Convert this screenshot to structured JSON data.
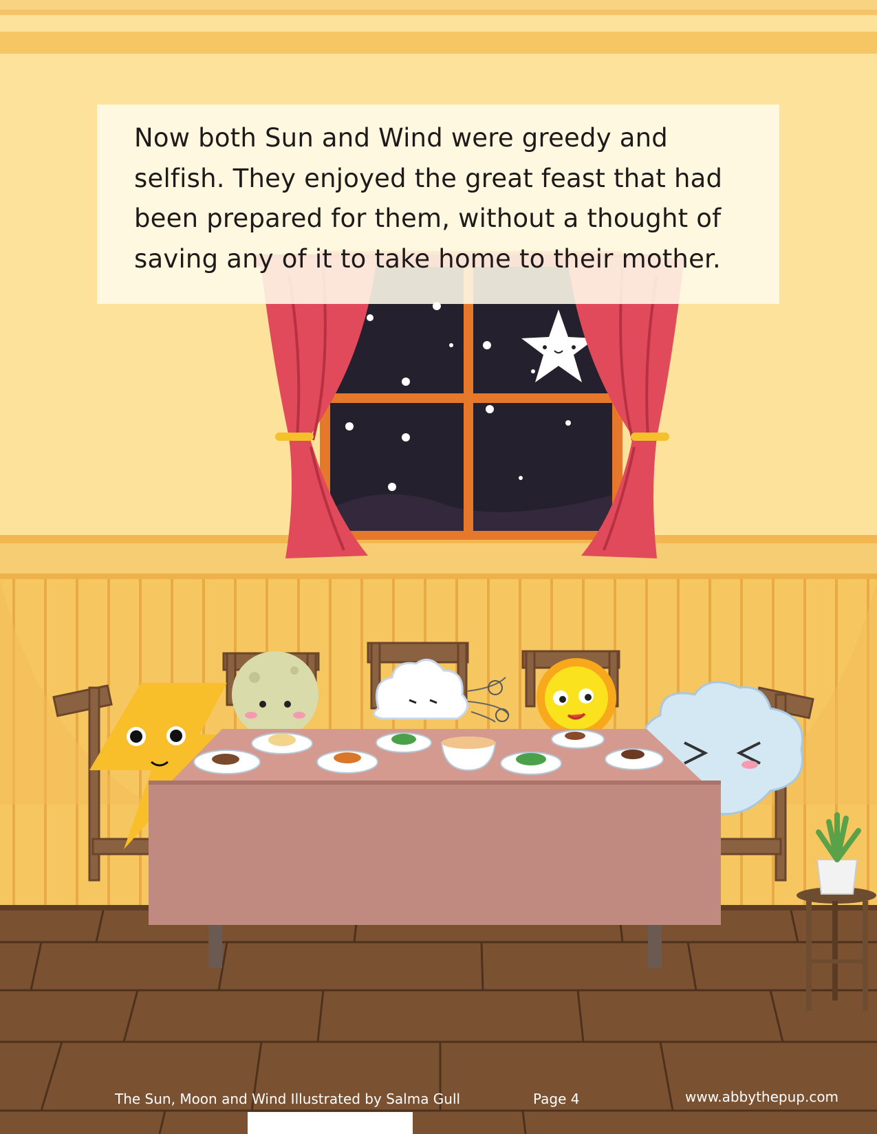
{
  "story": {
    "lines": [
      "Now both Sun and Wind were greedy and",
      "selfish. They enjoyed the great feast that had",
      "been prepared for them, without a thought of",
      "saving any of it to take home to their mother."
    ]
  },
  "footer": {
    "credit": "The Sun, Moon and Wind Illustrated by Salma Gull",
    "page": "Page 4",
    "url": "www.abbythepup.com"
  },
  "colors": {
    "wall": "#fce29a",
    "wainscot": "#f6c25a",
    "floor": "#7a5232",
    "curtain": "#e04a5a",
    "tablecloth": "#c08a80",
    "night_sky": "#25202e"
  },
  "characters": [
    "lightning-icon",
    "moon-icon",
    "wind-cloud-icon",
    "sun-icon",
    "cloud-icon"
  ]
}
